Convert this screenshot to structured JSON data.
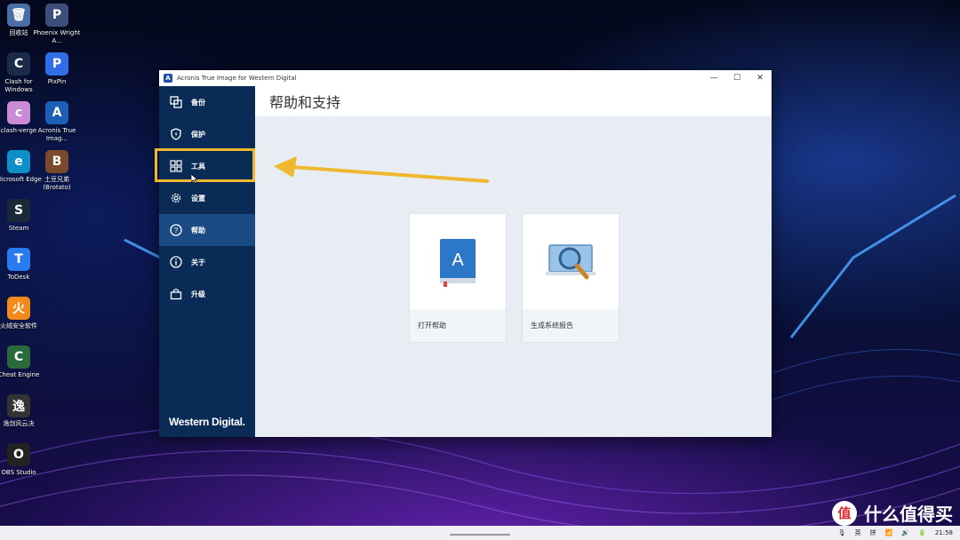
{
  "desktop": {
    "icons": [
      {
        "label": "回收站",
        "glyph": "🗑",
        "color": "#4a6fa5"
      },
      {
        "label": "Phoenix Wright A...",
        "glyph": "P",
        "color": "#3b4f7a"
      },
      {
        "label": "Clash for Windows",
        "glyph": "C",
        "color": "#1c2a4a"
      },
      {
        "label": "PixPin",
        "glyph": "P",
        "color": "#2f6ee8"
      },
      {
        "label": "clash-verge",
        "glyph": "c",
        "color": "#c98bd6"
      },
      {
        "label": "Acronis True Imag...",
        "glyph": "A",
        "color": "#1d5fb5"
      },
      {
        "label": "Microsoft Edge",
        "glyph": "e",
        "color": "#0f8fc7"
      },
      {
        "label": "土豆兄弟 (Brotato)",
        "glyph": "B",
        "color": "#7a4a2a"
      },
      {
        "label": "Steam",
        "glyph": "S",
        "color": "#1b2838"
      },
      {
        "label": "ToDesk",
        "glyph": "T",
        "color": "#2a7bf0"
      },
      {
        "label": "火绒安全软件",
        "glyph": "火",
        "color": "#f08a1c"
      },
      {
        "label": "Cheat Engine",
        "glyph": "C",
        "color": "#2a6a3a"
      },
      {
        "label": "逸剑风云决",
        "glyph": "逸",
        "color": "#333333"
      },
      {
        "label": "OBS Studio",
        "glyph": "O",
        "color": "#222222"
      }
    ]
  },
  "window": {
    "title": "Acronis True Image for Western Digital",
    "logo_glyph": "A",
    "controls": {
      "minimize": "—",
      "maximize": "☐",
      "close": "✕"
    }
  },
  "sidebar": {
    "items": [
      {
        "label": "备份",
        "icon": "copy-icon",
        "active": false
      },
      {
        "label": "保护",
        "icon": "shield-icon",
        "active": false
      },
      {
        "label": "工具",
        "icon": "grid-icon",
        "active": false
      },
      {
        "label": "设置",
        "icon": "gear-icon",
        "active": false
      },
      {
        "label": "帮助",
        "icon": "help-icon",
        "active": true
      },
      {
        "label": "关于",
        "icon": "info-icon",
        "active": false
      },
      {
        "label": "升级",
        "icon": "cart-icon",
        "active": false
      }
    ],
    "brand": "Western Digital."
  },
  "main": {
    "title": "帮助和支持",
    "cards": [
      {
        "label": "打开帮助",
        "icon": "book-icon",
        "glyph": "A"
      },
      {
        "label": "生成系统报告",
        "icon": "magnifier-laptop-icon"
      }
    ]
  },
  "taskbar": {
    "tray": [
      "🎙",
      "英",
      "拼",
      "📶",
      "🔊",
      "🔋"
    ],
    "time": "21:58"
  },
  "watermark": {
    "logo": "值",
    "text": "什么值得买"
  },
  "colors": {
    "sidebar": "#0b2b57",
    "active": "#1b4b85",
    "highlight": "#f0b82e",
    "content_bg": "#e7edf3"
  }
}
